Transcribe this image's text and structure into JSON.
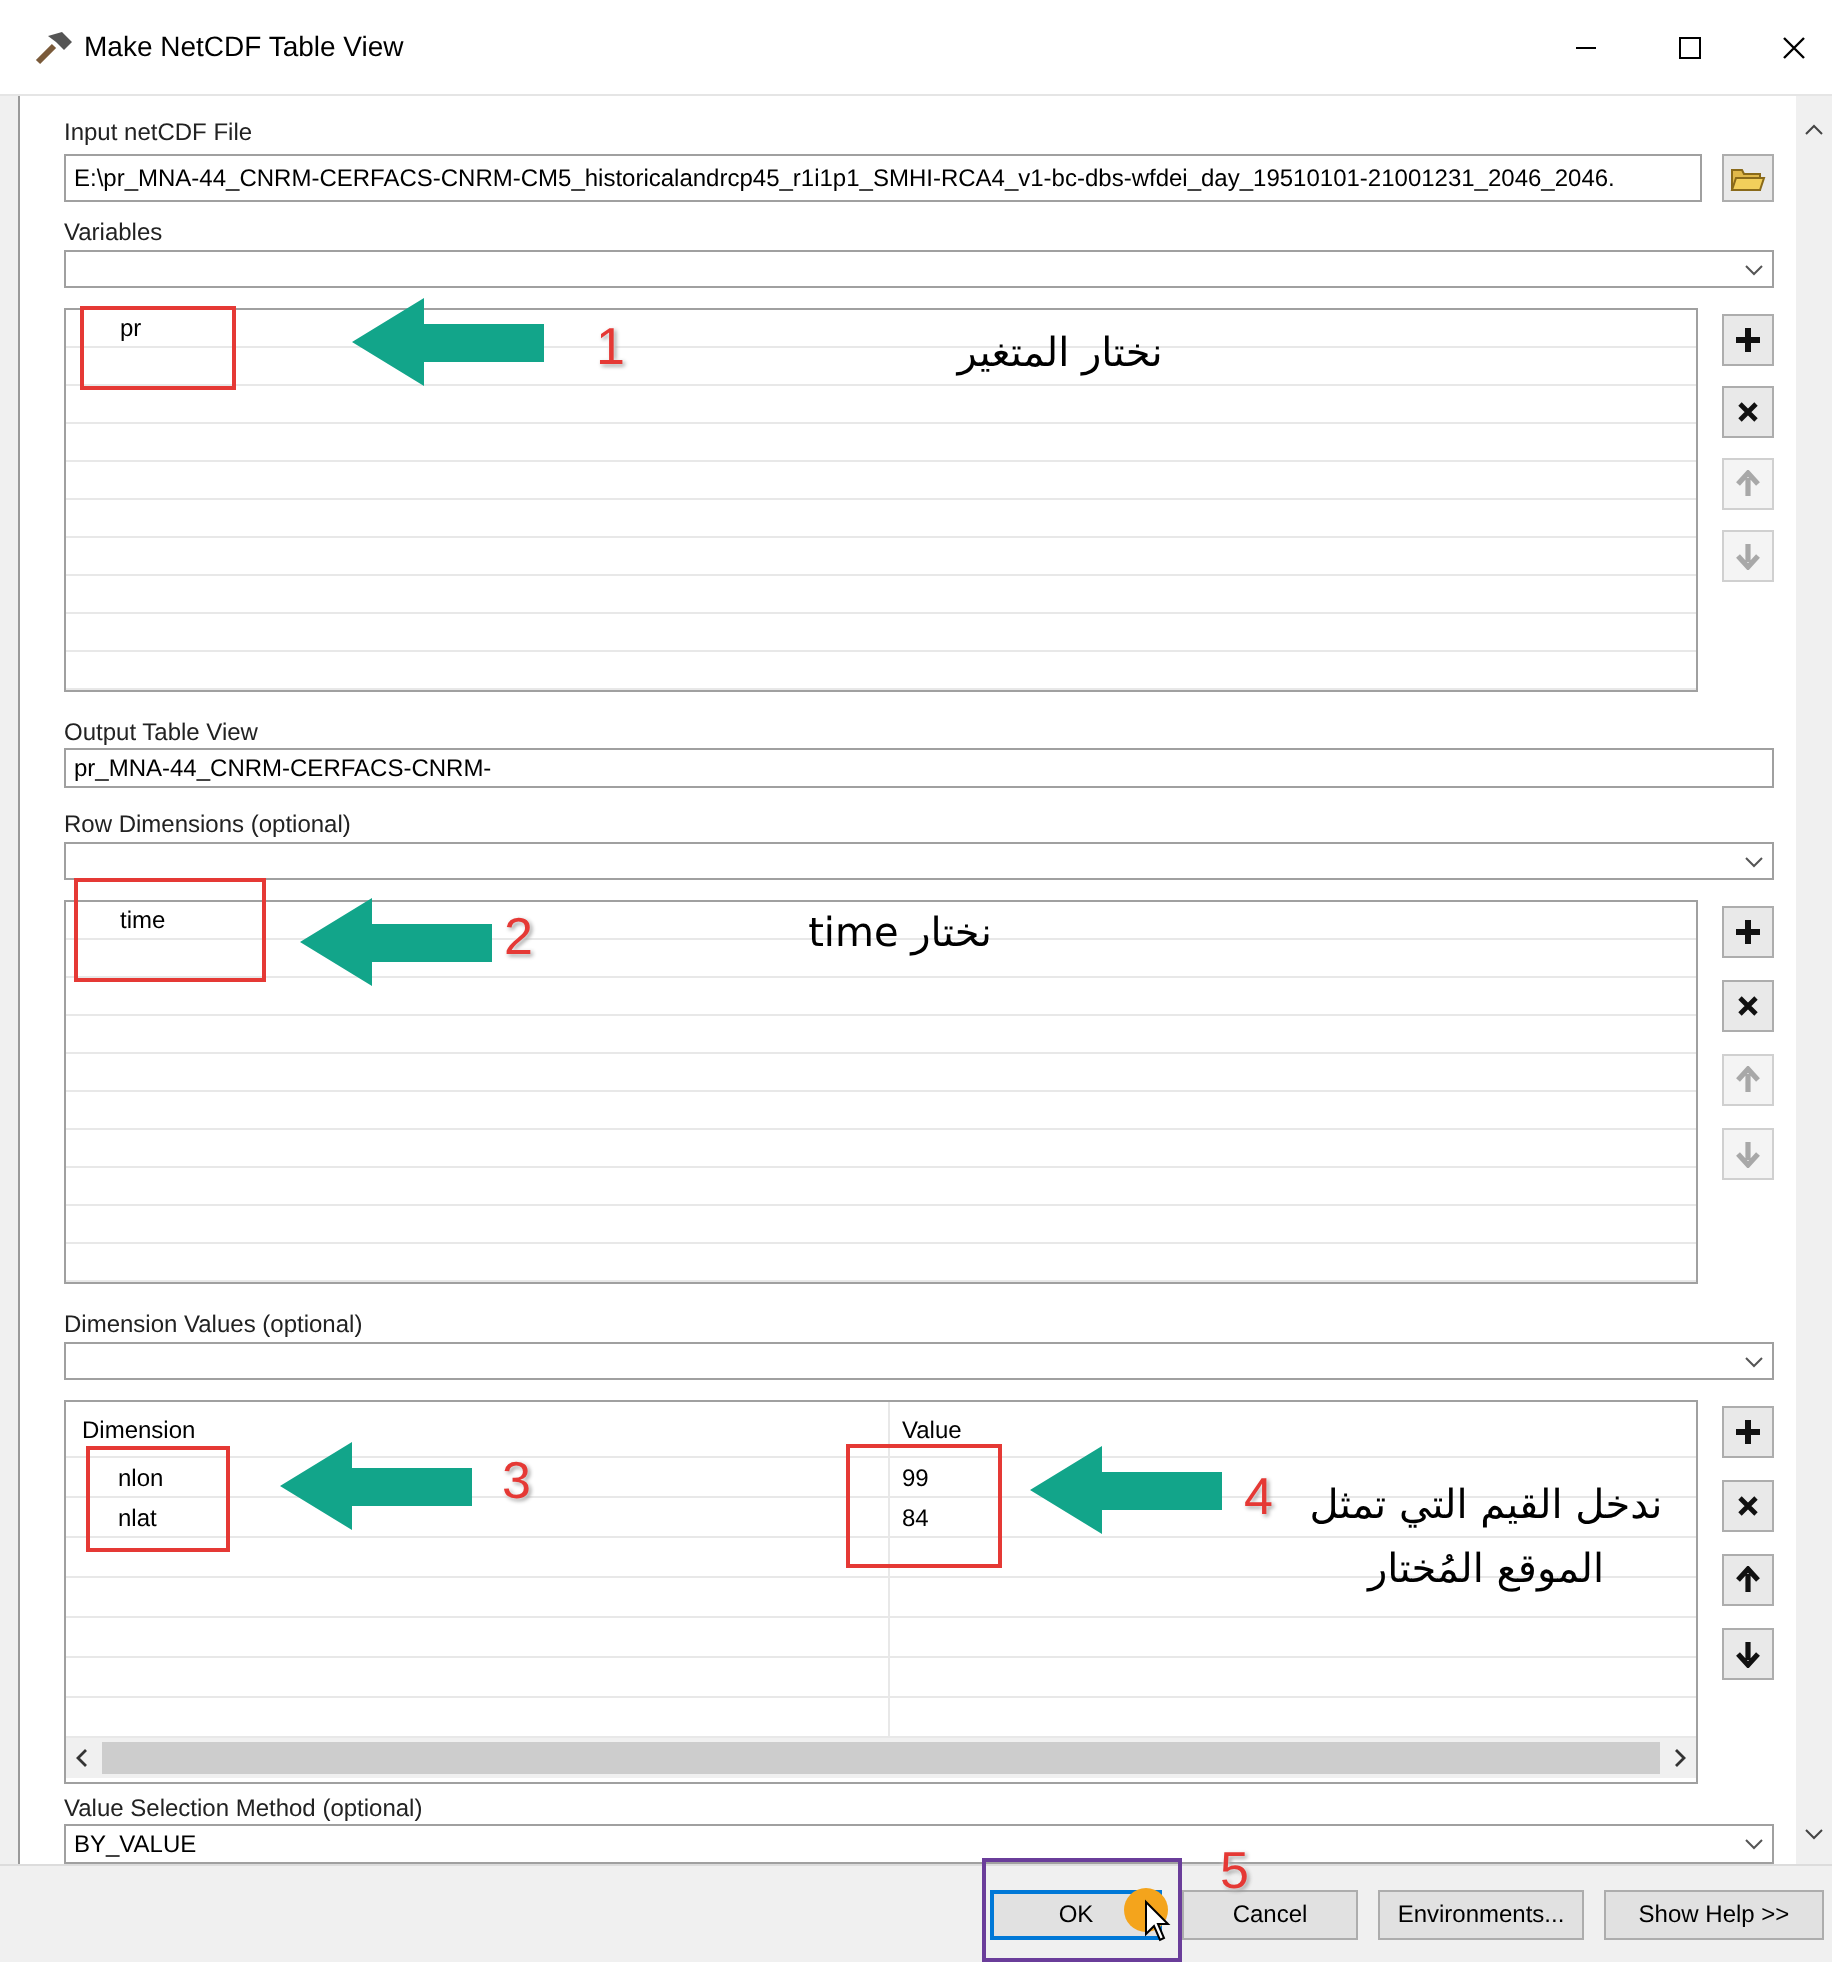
{
  "window": {
    "title": "Make NetCDF Table View"
  },
  "input_file": {
    "label": "Input netCDF File",
    "value": "E:\\pr_MNA-44_CNRM-CERFACS-CNRM-CM5_historicalandrcp45_r1i1p1_SMHI-RCA4_v1-bc-dbs-wfdei_day_19510101-21001231_2046_2046."
  },
  "variables": {
    "label": "Variables",
    "items": [
      "pr"
    ],
    "tools": [
      {
        "kind": "add",
        "disabled": false
      },
      {
        "kind": "remove",
        "disabled": false
      },
      {
        "kind": "up",
        "disabled": true
      },
      {
        "kind": "down",
        "disabled": true
      }
    ]
  },
  "output_table": {
    "label": "Output Table View",
    "value": "pr_MNA-44_CNRM-CERFACS-CNRM-"
  },
  "row_dimensions": {
    "label": "Row Dimensions (optional)",
    "items": [
      "time"
    ],
    "tools": [
      {
        "kind": "add",
        "disabled": false
      },
      {
        "kind": "remove",
        "disabled": false
      },
      {
        "kind": "up",
        "disabled": true
      },
      {
        "kind": "down",
        "disabled": true
      }
    ]
  },
  "dimension_values": {
    "label": "Dimension Values (optional)",
    "columns": [
      "Dimension",
      "Value"
    ],
    "rows": [
      [
        "nlon",
        "99"
      ],
      [
        "nlat",
        "84"
      ]
    ],
    "tools": [
      {
        "kind": "add",
        "disabled": false
      },
      {
        "kind": "remove",
        "disabled": false
      },
      {
        "kind": "up",
        "disabled": false
      },
      {
        "kind": "down",
        "disabled": false
      }
    ]
  },
  "selection_method": {
    "label": "Value Selection Method (optional)",
    "value": "BY_VALUE"
  },
  "buttons": [
    {
      "label": "OK",
      "default": true
    },
    {
      "label": "Cancel",
      "default": false
    },
    {
      "label": "Environments...",
      "default": false
    },
    {
      "label": "Show Help >>",
      "default": false
    }
  ],
  "annotations": [
    {
      "kind": "arrow",
      "number": "1",
      "text": "نختار المتغير",
      "color": "#e53935"
    },
    {
      "kind": "arrow",
      "number": "2",
      "text": "نختار time",
      "color": "#e53935"
    },
    {
      "kind": "arrow",
      "number": "3",
      "color": "#e53935"
    },
    {
      "kind": "arrow",
      "number": "4",
      "text": "ندخل القيم التي تمثل الموقع المُختار",
      "color": "#e53935"
    },
    {
      "kind": "frame",
      "number": "5",
      "color": "#6a3d9a"
    }
  ]
}
